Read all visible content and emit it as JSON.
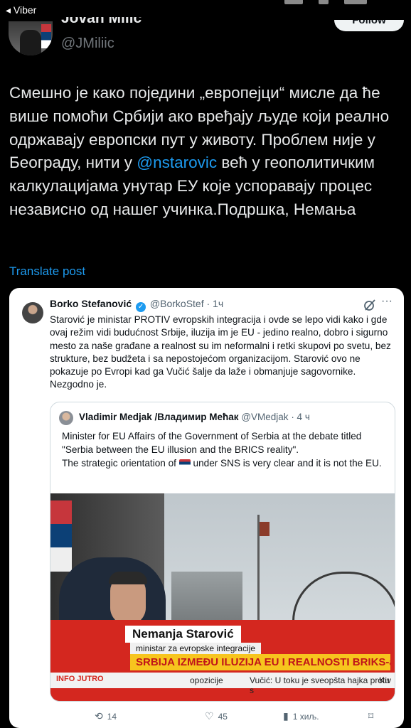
{
  "status_bar": {
    "back_label": "◂ Viber"
  },
  "profile": {
    "name": "Jovan Milić",
    "handle": "@JMiliic",
    "follow_label": "Follow"
  },
  "post": {
    "text_before_mention": "Смешно је како поједини „европејци“ мисле да ће више помоћи Србији ако вређају људе који реално одржавају европски пут у животу. Проблем није у Београду, нити у ",
    "mention": "@nstarovic",
    "text_after_mention": " већ у геополитичким калкулацијама унутар ЕУ које успоравају процес независно од нашег учинка.Подршка, Немања",
    "translate_label": "Translate post"
  },
  "embedded_tweet": {
    "author": "Borko Stefanović",
    "handle": "@BorkoStef",
    "time": "· 1ч",
    "more": "···",
    "text": "Starović je ministar PROTIV evropskih integracija i ovde se lepo vidi kako i gde ovaj režim vidi budućnost Srbije, iluzija im je EU - jedino realno, dobro i sigurno mesto za naše građane a realnost su im neformalni i retki skupovi po svetu, bez strukture, bez budžeta i sa nepostojećom organizacijom. Starović ovo ne pokazuje po Evropi kad ga Vučić šalje da laže i obmanjuje sagovornike. Nezgodno je.",
    "quote": {
      "author": "Vladimir Medjak /Владимир Мећак",
      "handle": "@VMedjak",
      "time": "· 4 ч",
      "line1": "Minister for EU Affairs of the Government of Serbia at the debate titled \"Serbia between the EU illusion and the BRICS reality\".",
      "line2_before": "The strategic orientation of ",
      "line2_after": " under SNS is very clear and it is not the EU.",
      "video": {
        "lower_third_name": "Nemanja Starović",
        "lower_third_role": "ministar za evropske integracije",
        "headline": "SRBIJA IZMEĐU ILUZIJA EU I REALNOSTI BRIKS-a",
        "channel_logo": "INFO JUTRO",
        "ticker_1": "opozicije",
        "ticker_2": "Vučić: U toku je sveopšta hajka protiv s",
        "ticker_3": "Ku"
      }
    },
    "actions": {
      "retweets": "14",
      "likes": "45",
      "views": "1 хиљ."
    }
  }
}
